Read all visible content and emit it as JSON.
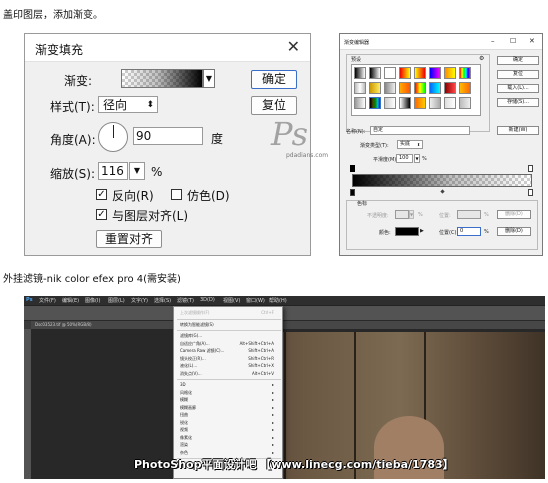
{
  "captions": {
    "top": "盖印图层，添加渐变。",
    "middle": "外挂滤镜-nik color efex pro 4(需安装)"
  },
  "gradient_fill_dialog": {
    "title": "渐变填充",
    "gradient_label": "渐变:",
    "style_label": "样式(T):",
    "style_value": "径向",
    "angle_label": "角度(A):",
    "angle_value": "90",
    "angle_unit": "度",
    "scale_label": "缩放(S):",
    "scale_value": "116",
    "scale_unit": "%",
    "reverse_label": "反向(R)",
    "reverse_checked": true,
    "dither_label": "仿色(D)",
    "dither_checked": false,
    "align_label": "与图层对齐(L)",
    "align_checked": true,
    "reset_align_label": "重置对齐",
    "ok_label": "确定",
    "reset_label": "复位"
  },
  "gradient_editor": {
    "title": "渐变编辑器",
    "presets_label": "预设",
    "ok_label": "确定",
    "reset_label": "复位",
    "load_label": "载入(L)...",
    "save_label": "存储(S)...",
    "name_label": "名称(N):",
    "name_value": "自定",
    "new_label": "新建(W)",
    "type_label": "渐变类型(T):",
    "type_value": "实底",
    "smooth_label": "平滑度(M):",
    "smooth_value": "100",
    "smooth_unit": "%",
    "stops_label": "色标",
    "opacity_label": "不透明度:",
    "opacity_unit": "%",
    "position_label": "位置:",
    "position_unit": "%",
    "delete_label": "删除(D)",
    "color_label": "颜色:",
    "color_position_label": "位置(C):",
    "color_position_value": "0",
    "color_delete_label": "删除(D)"
  },
  "watermark": {
    "ps_logo": "Ps",
    "ps_site": "pdadians.com",
    "bottom_text": "PhotoShop平面设计吧 【www.linecg.com/tieba/1783】"
  },
  "ps_window": {
    "logo": "Ps",
    "menus": [
      "文件(F)",
      "编辑(E)",
      "图像(I)",
      "图层(L)",
      "文字(Y)",
      "选择(S)",
      "滤镜(T)",
      "3D(D)",
      "视图(V)",
      "窗口(W)",
      "帮助(H)"
    ],
    "tab_text": "Dsc03523.tif @ 50%(RGB/8)",
    "filter_menu": [
      {
        "label": "上次滤镜操作(F)",
        "shortcut": "Ctrl+F",
        "disabled": true
      },
      {
        "label": "转换为智能滤镜(S)",
        "shortcut": ""
      },
      {
        "label": "滤镜库(G)...",
        "shortcut": ""
      },
      {
        "label": "自适应广角(A)...",
        "shortcut": "Alt+Shift+Ctrl+A"
      },
      {
        "label": "Camera Raw 滤镜(C)...",
        "shortcut": "Shift+Ctrl+A"
      },
      {
        "label": "镜头校正(R)...",
        "shortcut": "Shift+Ctrl+R"
      },
      {
        "label": "液化(L)...",
        "shortcut": "Shift+Ctrl+X"
      },
      {
        "label": "消失点(V)...",
        "shortcut": "Alt+Ctrl+V"
      },
      {
        "label": "3D",
        "shortcut": "▸"
      },
      {
        "label": "风格化",
        "shortcut": "▸"
      },
      {
        "label": "模糊",
        "shortcut": "▸"
      },
      {
        "label": "模糊画廊",
        "shortcut": "▸"
      },
      {
        "label": "扭曲",
        "shortcut": "▸"
      },
      {
        "label": "锐化",
        "shortcut": "▸"
      },
      {
        "label": "视频",
        "shortcut": "▸"
      },
      {
        "label": "像素化",
        "shortcut": "▸"
      },
      {
        "label": "渲染",
        "shortcut": "▸"
      },
      {
        "label": "杂色",
        "shortcut": "▸"
      },
      {
        "label": "其它",
        "shortcut": "▸"
      }
    ]
  }
}
